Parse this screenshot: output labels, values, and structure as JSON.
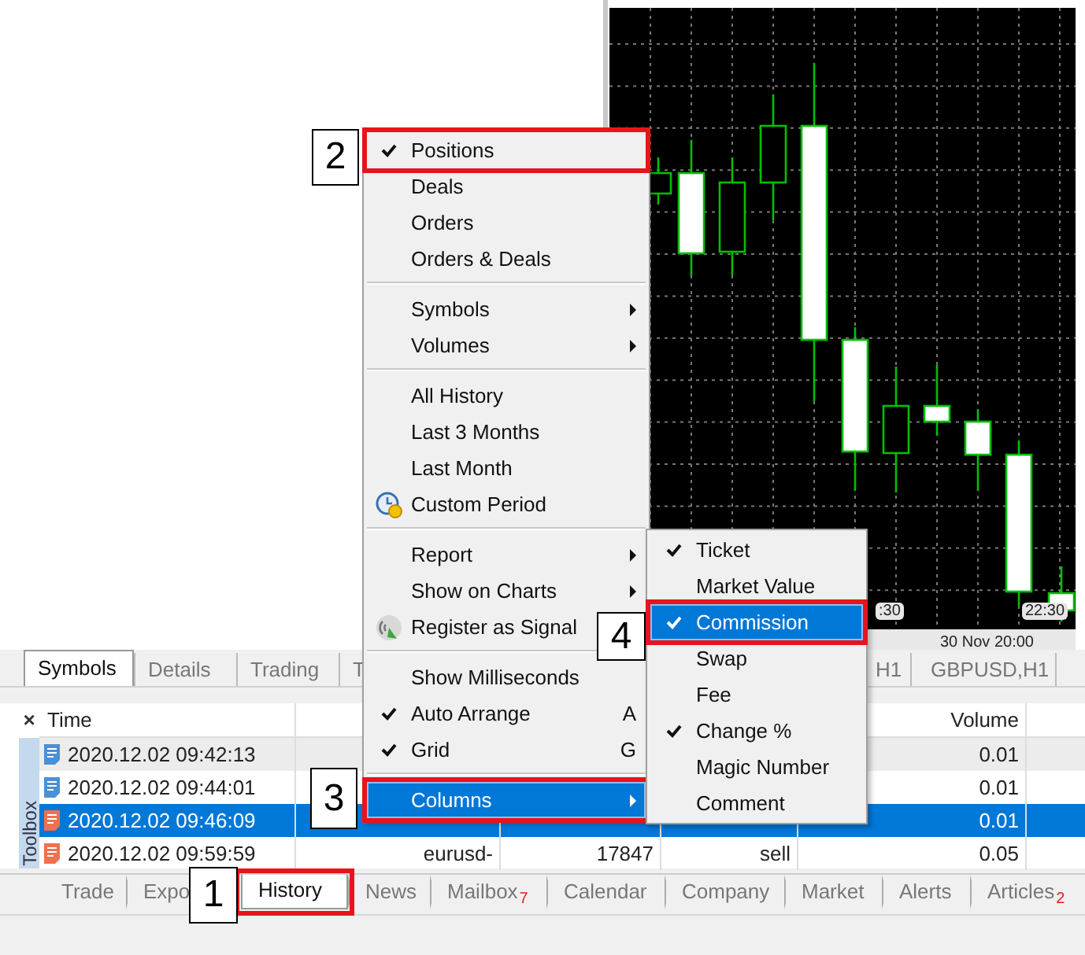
{
  "chart": {
    "time_labels": [
      ":30",
      "22:30",
      "30 Nov 20:00"
    ]
  },
  "market_watch_tabs": [
    {
      "label": "Symbols",
      "selected": true
    },
    {
      "label": "Details",
      "selected": false
    },
    {
      "label": "Trading",
      "selected": false
    },
    {
      "label": "T",
      "selected": false
    }
  ],
  "chart_tabs": [
    {
      "label": "H1",
      "selected": false
    },
    {
      "label": "GBPUSD,H1",
      "selected": false
    }
  ],
  "toolbox": {
    "close": "×",
    "title": "Toolbox"
  },
  "table": {
    "columns": [
      "Time",
      "Volume"
    ],
    "rows": [
      {
        "time": "2020.12.02 09:42:13",
        "volume": "0.01",
        "color": "#4a90d9",
        "selected": false
      },
      {
        "time": "2020.12.02 09:44:01",
        "volume": "0.01",
        "color": "#4a90d9",
        "selected": false
      },
      {
        "time": "2020.12.02 09:46:09",
        "volume": "0.01",
        "color": "#f07050",
        "selected": true
      },
      {
        "time": "2020.12.02 09:59:59",
        "symbol": "eurusd-",
        "ticket": "17847",
        "type": "sell",
        "volume": "0.05",
        "color": "#f07050",
        "selected": false
      }
    ]
  },
  "bottom_tabs": [
    {
      "label": "Trade",
      "selected": false,
      "highlighted": false
    },
    {
      "label": "Expo",
      "selected": false,
      "highlighted": false
    },
    {
      "label": "History",
      "selected": true,
      "highlighted": true
    },
    {
      "label": "News",
      "selected": false,
      "highlighted": false
    },
    {
      "label": "Mailbox",
      "badge": "7",
      "selected": false,
      "highlighted": false
    },
    {
      "label": "Calendar",
      "selected": false,
      "highlighted": false
    },
    {
      "label": "Company",
      "selected": false,
      "highlighted": false
    },
    {
      "label": "Market",
      "selected": false,
      "highlighted": false
    },
    {
      "label": "Alerts",
      "selected": false,
      "highlighted": false
    },
    {
      "label": "Articles",
      "badge": "2",
      "selected": false,
      "highlighted": false
    }
  ],
  "menu": {
    "items": [
      {
        "kind": "item",
        "label": "Positions",
        "checked": true,
        "selected": false,
        "highlighted": true
      },
      {
        "kind": "item",
        "label": "Deals",
        "checked": false,
        "selected": false,
        "highlighted": false
      },
      {
        "kind": "item",
        "label": "Orders",
        "checked": false,
        "selected": false,
        "highlighted": false
      },
      {
        "kind": "item",
        "label": "Orders & Deals",
        "checked": false,
        "selected": false,
        "highlighted": false
      },
      {
        "kind": "separator"
      },
      {
        "kind": "item",
        "label": "Symbols",
        "checked": false,
        "selected": false,
        "highlighted": false,
        "submenu": true
      },
      {
        "kind": "item",
        "label": "Volumes",
        "checked": false,
        "selected": false,
        "highlighted": false,
        "submenu": true
      },
      {
        "kind": "separator"
      },
      {
        "kind": "item",
        "label": "All History",
        "checked": false,
        "selected": false,
        "highlighted": false
      },
      {
        "kind": "item",
        "label": "Last 3 Months",
        "checked": false,
        "selected": false,
        "highlighted": false
      },
      {
        "kind": "item",
        "label": "Last Month",
        "checked": false,
        "selected": false,
        "highlighted": false
      },
      {
        "kind": "period",
        "label": "Custom Period",
        "checked": false,
        "selected": false,
        "highlighted": false
      },
      {
        "kind": "separator"
      },
      {
        "kind": "item",
        "label": "Report",
        "checked": false,
        "selected": false,
        "highlighted": false,
        "submenu": true
      },
      {
        "kind": "item",
        "label": "Show on Charts",
        "checked": false,
        "selected": false,
        "highlighted": false,
        "submenu": true
      },
      {
        "kind": "signal",
        "label": "Register as Signal",
        "checked": false,
        "selected": false,
        "highlighted": false
      },
      {
        "kind": "separator"
      },
      {
        "kind": "item",
        "label": "Show Milliseconds",
        "checked": false,
        "selected": false,
        "highlighted": false
      },
      {
        "kind": "item",
        "label": "Auto Arrange",
        "checked": true,
        "selected": false,
        "highlighted": false,
        "shortcut": "A"
      },
      {
        "kind": "item",
        "label": "Grid",
        "checked": true,
        "selected": false,
        "highlighted": false,
        "shortcut": "G"
      },
      {
        "kind": "separator"
      },
      {
        "kind": "item",
        "label": "Columns",
        "checked": false,
        "selected": true,
        "highlighted": true,
        "submenu": true
      }
    ]
  },
  "columns_submenu": {
    "items": [
      {
        "label": "Ticket",
        "checked": true,
        "selected": false,
        "highlighted": false
      },
      {
        "label": "Market Value",
        "checked": false,
        "selected": false,
        "highlighted": false
      },
      {
        "label": "Commission",
        "checked": true,
        "selected": true,
        "highlighted": true
      },
      {
        "label": "Swap",
        "checked": false,
        "selected": false,
        "highlighted": false
      },
      {
        "label": "Fee",
        "checked": false,
        "selected": false,
        "highlighted": false
      },
      {
        "label": "Change %",
        "checked": true,
        "selected": false,
        "highlighted": false
      },
      {
        "label": "Magic Number",
        "checked": false,
        "selected": false,
        "highlighted": false
      },
      {
        "label": "Comment",
        "checked": false,
        "selected": false,
        "highlighted": false
      }
    ]
  },
  "callouts": [
    "1",
    "2",
    "3",
    "4"
  ]
}
